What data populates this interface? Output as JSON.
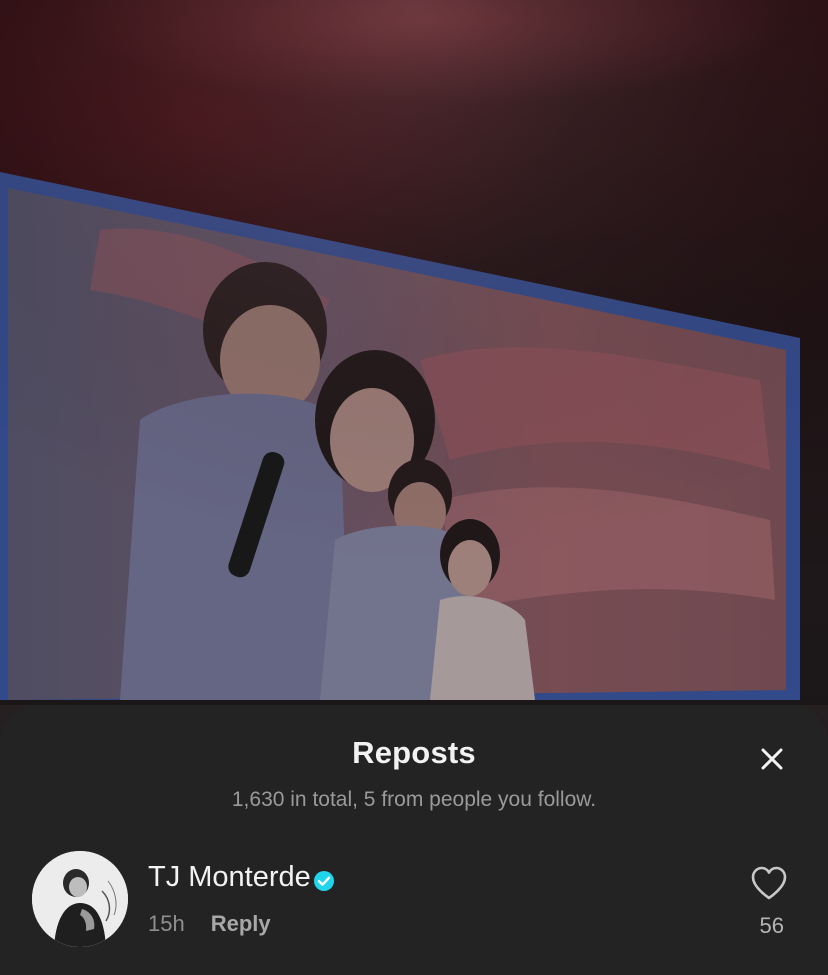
{
  "sheet": {
    "title": "Reposts",
    "subtitle": "1,630 in total, 5 from people you follow."
  },
  "reposts": [
    {
      "name": "TJ Monterde",
      "verified": true,
      "time": "15h",
      "reply_label": "Reply",
      "like_count": "56"
    }
  ],
  "icons": {
    "close": "close-icon",
    "verified": "verified-badge-icon",
    "like": "heart-outline-icon"
  },
  "colors": {
    "sheet_bg": "#232323",
    "verified": "#20d5ec",
    "text_primary": "#f2f2f2",
    "text_secondary": "#9a9a9a"
  }
}
